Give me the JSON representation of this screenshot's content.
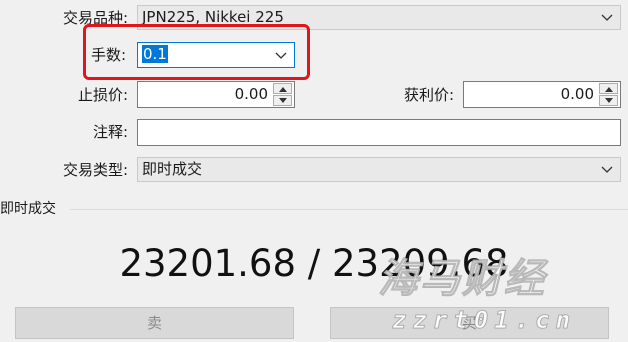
{
  "symbol": {
    "label": "交易品种:",
    "value": "JPN225, Nikkei 225"
  },
  "volume": {
    "label": "手数:",
    "value": "0.1"
  },
  "stop_loss": {
    "label": "止损价:",
    "value": "0.00"
  },
  "take_profit": {
    "label": "获利价:",
    "value": "0.00"
  },
  "comment": {
    "label": "注释:",
    "value": ""
  },
  "order_type": {
    "label": "交易类型:",
    "value": "即时成交"
  },
  "execution": {
    "title": "即时成交",
    "price": "23201.68 / 23209.68"
  },
  "buttons": {
    "sell": "卖",
    "buy": "买"
  },
  "watermark": {
    "main": "海马财经",
    "sub": "zzrt01.cn"
  },
  "colors": {
    "highlight": "#e0161e",
    "selection": "#0078d7",
    "background": "#f0f0f0"
  }
}
